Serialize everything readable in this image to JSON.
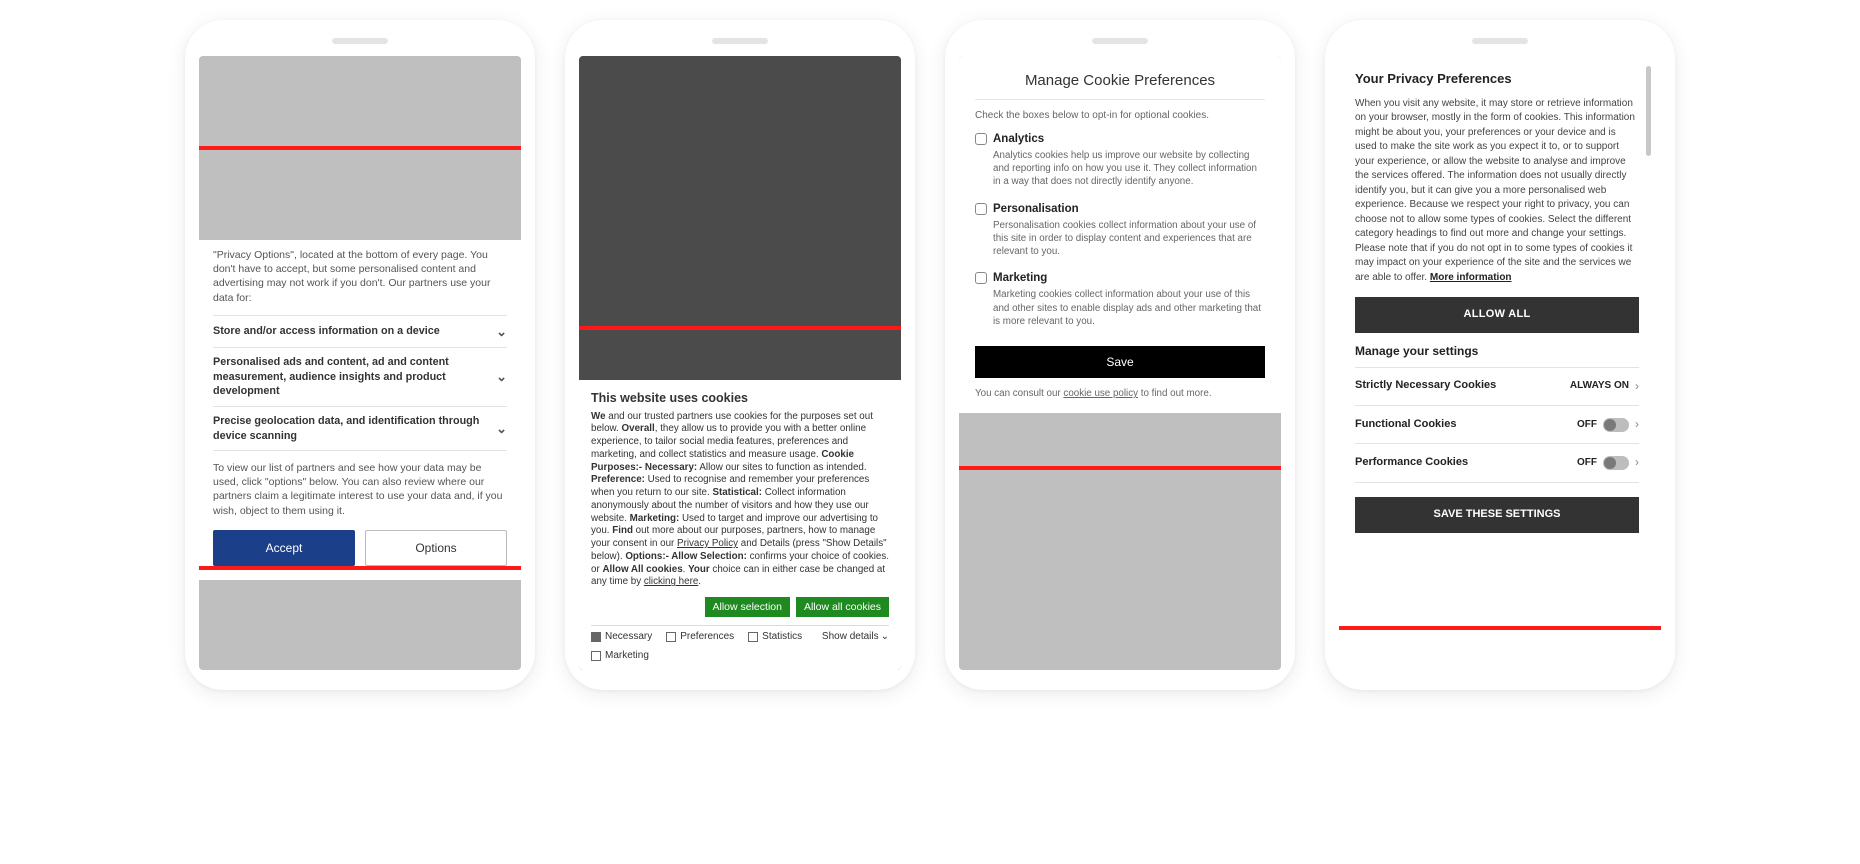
{
  "phone1": {
    "intro": "\"Privacy Options\", located at the bottom of every page. You don't have to accept, but some personalised content and advertising may not work if you don't. Our partners use your data for:",
    "rows": [
      "Store and/or access information on a device",
      "Personalised ads and content, ad and content measurement, audience insights and product development",
      "Precise geolocation data, and identification through device scanning"
    ],
    "note": "To view our list of partners and see how your data may be used, click \"options\" below. You can also review where our partners claim a legitimate interest to use your data and, if you wish, object to them using it.",
    "accept": "Accept",
    "options": "Options"
  },
  "phone2": {
    "title": "This website uses cookies",
    "pieces": {
      "we": "We",
      "t1": " and our trusted partners use cookies for the purposes set out below. ",
      "overall": "Overall",
      "t2": ", they allow us to provide you with a better online experience, to tailor social media features, preferences and marketing, and collect statistics and measure usage. ",
      "cpurp": "Cookie Purposes:- Necessary:",
      "t3": " Allow our sites to function as intended. ",
      "pref": "Preference:",
      "t4": " Used to recognise and remember your preferences when you return to our site. ",
      "stat": "Statistical:",
      "t5": " Collect information anonymously about the number of visitors and how they use our website. ",
      "mkt": "Marketing:",
      "t6": " Used to target and improve our advertising to you. ",
      "find": "Find",
      "t7": " out more about our purposes, partners, how to manage your consent in our ",
      "pp": "Privacy Policy",
      "t8": " and Details (press \"Show Details\" below). ",
      "opts": "Options:- Allow Selection:",
      "t9": " confirms your choice of cookies. or ",
      "allowall": "Allow All cookies",
      "t10": ". ",
      "your": "Your",
      "t11": " choice can in either case be changed at any time by ",
      "click": "clicking here",
      "dot": "."
    },
    "btn_sel": "Allow selection",
    "btn_all": "Allow all cookies",
    "checks": {
      "necessary": "Necessary",
      "preferences": "Preferences",
      "statistics": "Statistics",
      "marketing": "Marketing"
    },
    "show": "Show details"
  },
  "phone3": {
    "title": "Manage Cookie Preferences",
    "intro": "Check the boxes below to opt-in for optional cookies.",
    "items": [
      {
        "name": "Analytics",
        "desc": "Analytics cookies help us improve our website by collecting and reporting info on how you use it. They collect information in a way that does not directly identify anyone."
      },
      {
        "name": "Personalisation",
        "desc": "Personalisation cookies collect information about your use of this site in order to display content and experiences that are relevant to you."
      },
      {
        "name": "Marketing",
        "desc": "Marketing cookies collect information about your use of this and other sites to enable display ads and other marketing that is more relevant to you."
      }
    ],
    "save": "Save",
    "foot_a": "You can consult our ",
    "foot_link": "cookie use policy",
    "foot_b": " to find out more."
  },
  "phone4": {
    "title": "Your Privacy Preferences",
    "body": "When you visit any website, it may store or retrieve information on your browser, mostly in the form of cookies. This information might be about you, your preferences or your device and is used to make the site work as you expect it to, or to support your experience, or allow the website to analyse and improve the services offered. The information does not usually directly identify you, but it can give you a more personalised web experience. Because we respect your right to privacy, you can choose not to allow some types of cookies. Select the different category headings to find out more and change your settings. Please note that if you do not opt in to some types of cookies it may impact on your experience of the site and the services we are able to offer.  ",
    "more": "More information",
    "allow": "ALLOW ALL",
    "manage": "Manage your settings",
    "rows": [
      {
        "name": "Strictly Necessary Cookies",
        "state": "ALWAYS ON",
        "toggle": false
      },
      {
        "name": "Functional Cookies",
        "state": "OFF",
        "toggle": true
      },
      {
        "name": "Performance Cookies",
        "state": "OFF",
        "toggle": true
      }
    ],
    "save": "SAVE THESE SETTINGS"
  }
}
